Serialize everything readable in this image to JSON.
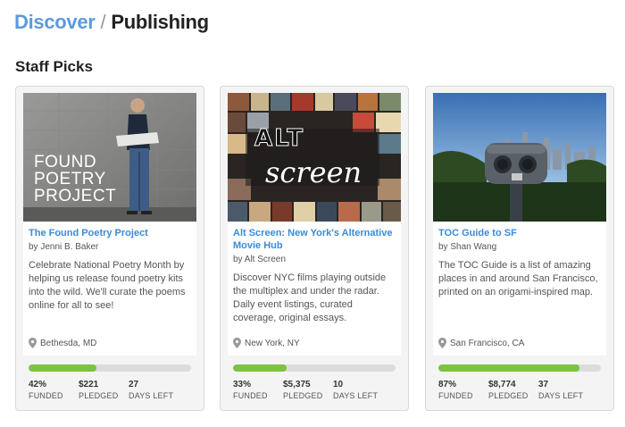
{
  "breadcrumb": {
    "parent": "Discover",
    "separator": "/",
    "current": "Publishing"
  },
  "section_title": "Staff Picks",
  "colors": {
    "link": "#3a8bd8",
    "progress": "#7cc243",
    "progress_track": "#dcdcdc"
  },
  "cards": [
    {
      "image_text": "FOUND POETRY PROJECT",
      "title": "The Found Poetry Project",
      "author": "by Jenni B. Baker",
      "description": "Celebrate National Poetry Month by helping us release found poetry kits into the wild. We'll curate the poems online for all to see!",
      "location": "Bethesda, MD",
      "progress": 0.42,
      "funded": "42%",
      "funded_label": "FUNDED",
      "pledged": "$221",
      "pledged_label": "PLEDGED",
      "days": "27",
      "days_label": "DAYS LEFT"
    },
    {
      "image_text_top": "ALT",
      "image_text_bottom": "screen",
      "title": "Alt Screen: New York's Alternative Movie Hub",
      "author": "by Alt Screen",
      "description": "Discover NYC films playing outside the multiplex and under the radar. Daily event listings, curated coverage, original essays.",
      "location": "New York, NY",
      "progress": 0.33,
      "funded": "33%",
      "funded_label": "FUNDED",
      "pledged": "$5,375",
      "pledged_label": "PLEDGED",
      "days": "10",
      "days_label": "DAYS LEFT"
    },
    {
      "title": "TOC Guide to SF",
      "author": "by Shan Wang",
      "description": "The TOC Guide is a list of amazing places in and around San Francisco, printed on an origami-inspired map.",
      "location": "San Francisco, CA",
      "progress": 0.87,
      "funded": "87%",
      "funded_label": "FUNDED",
      "pledged": "$8,774",
      "pledged_label": "PLEDGED",
      "days": "37",
      "days_label": "DAYS LEFT"
    }
  ]
}
